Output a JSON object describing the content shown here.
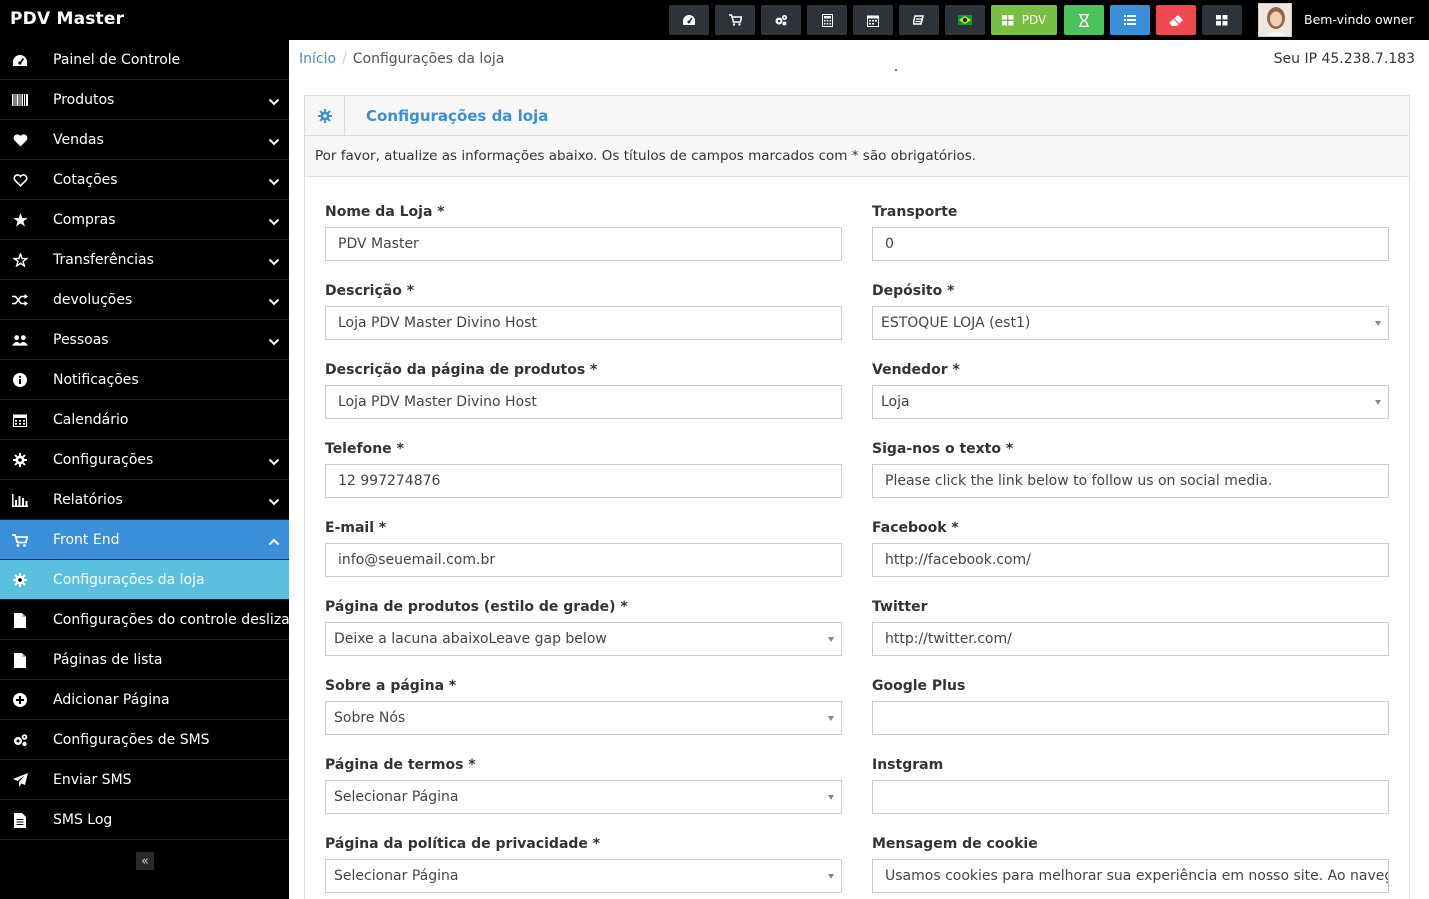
{
  "app": {
    "brand": "PDV Master",
    "pdv_label": "PDV",
    "welcome": "Bem-vindo owner"
  },
  "toolbar": {
    "icons": [
      "dashboard-icon",
      "cart-icon",
      "cogs-icon",
      "calculator-icon",
      "calendar-icon",
      "refresh-icon",
      "brazil-flag-icon",
      "pos-grid-icon",
      "hourglass-icon",
      "list-icon",
      "eraser-icon",
      "grid-icon"
    ]
  },
  "sidebar": {
    "items": [
      {
        "label": "Painel de Controle",
        "icon": "dashboard-icon",
        "expandable": false
      },
      {
        "label": "Produtos",
        "icon": "barcode-icon",
        "expandable": true
      },
      {
        "label": "Vendas",
        "icon": "heart-icon",
        "expandable": true
      },
      {
        "label": "Cotações",
        "icon": "heart-outline-icon",
        "expandable": true
      },
      {
        "label": "Compras",
        "icon": "star-icon",
        "expandable": true
      },
      {
        "label": "Transferências",
        "icon": "star-outline-icon",
        "expandable": true
      },
      {
        "label": "devoluções",
        "icon": "random-icon",
        "expandable": true
      },
      {
        "label": "Pessoas",
        "icon": "users-icon",
        "expandable": true
      },
      {
        "label": "Notificações",
        "icon": "info-icon",
        "expandable": false
      },
      {
        "label": "Calendário",
        "icon": "calendar-icon",
        "expandable": false
      },
      {
        "label": "Configurações",
        "icon": "cog-icon",
        "expandable": true
      },
      {
        "label": "Relatórios",
        "icon": "bar-chart-icon",
        "expandable": true
      },
      {
        "label": "Front End",
        "icon": "cart-icon",
        "expandable": true,
        "state": "open"
      },
      {
        "label": "Configurações da loja",
        "icon": "cog-icon",
        "expandable": false,
        "state": "selected"
      },
      {
        "label": "Configurações do controle deslizante",
        "icon": "file-icon",
        "expandable": false
      },
      {
        "label": "Páginas de lista",
        "icon": "file-icon",
        "expandable": false
      },
      {
        "label": "Adicionar Página",
        "icon": "plus-circle-icon",
        "expandable": false
      },
      {
        "label": "Configurações de SMS",
        "icon": "cogs-icon",
        "expandable": false
      },
      {
        "label": "Enviar SMS",
        "icon": "paper-plane-icon",
        "expandable": false
      },
      {
        "label": "SMS Log",
        "icon": "file-text-icon",
        "expandable": false
      }
    ],
    "collapse_label": "«"
  },
  "breadcrumb": {
    "home": "Início",
    "current": "Configurações da loja"
  },
  "ip_text": "Seu IP 45.238.7.183",
  "panel": {
    "title": "Configurações da loja",
    "note": "Por favor, atualize as informações abaixo. Os títulos de campos marcados com * são obrigatórios."
  },
  "form": {
    "left": [
      {
        "label": "Nome da Loja *",
        "value": "PDV Master",
        "type": "input"
      },
      {
        "label": "Descrição *",
        "value": "Loja  PDV Master Divino Host",
        "type": "input"
      },
      {
        "label": "Descrição da página de produtos *",
        "value": "Loja  PDV Master Divino Host",
        "type": "input"
      },
      {
        "label": "Telefone *",
        "value": "12 997274876",
        "type": "input"
      },
      {
        "label": "E-mail *",
        "value": "info@seuemail.com.br",
        "type": "input"
      },
      {
        "label": "Página de produtos (estilo de grade) *",
        "value": "Deixe a lacuna abaixoLeave gap below",
        "type": "select"
      },
      {
        "label": "Sobre a página *",
        "value": "Sobre Nós",
        "type": "select"
      },
      {
        "label": "Página de termos *",
        "value": "Selecionar Página",
        "type": "select"
      },
      {
        "label": "Página da política de privacidade *",
        "value": "Selecionar Página",
        "type": "select"
      }
    ],
    "right": [
      {
        "label": "Transporte",
        "value": "0",
        "type": "input"
      },
      {
        "label": "Depósito *",
        "value": "ESTOQUE LOJA (est1)",
        "type": "select"
      },
      {
        "label": "Vendedor *",
        "value": "Loja",
        "type": "select"
      },
      {
        "label": "Siga-nos o texto *",
        "value": "Please click the link below to follow us on social media.",
        "type": "input"
      },
      {
        "label": "Facebook *",
        "value": "http://facebook.com/",
        "type": "input"
      },
      {
        "label": "Twitter",
        "value": "http://twitter.com/",
        "type": "input"
      },
      {
        "label": "Google Plus",
        "value": "",
        "type": "input"
      },
      {
        "label": "Instgram",
        "value": "",
        "type": "input"
      },
      {
        "label": "Mensagem de cookie",
        "value": "Usamos cookies para melhorar sua experiência em nosso site. Ao navegar nest",
        "type": "input"
      }
    ]
  },
  "colors": {
    "accent": "#3a8fd9",
    "sub_active": "#5bc0de",
    "pdv_green": "#78c044",
    "hourglass_green": "#4cc25a",
    "eraser_red": "#ef4a52"
  }
}
